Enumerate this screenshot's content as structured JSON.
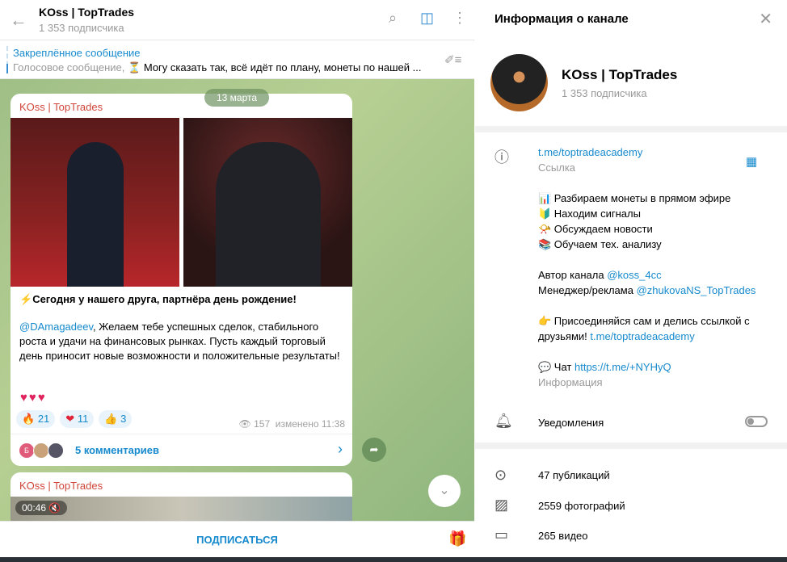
{
  "header": {
    "title": "KOss | TopTrades",
    "subtitle": "1 353 подписчика"
  },
  "pinned": {
    "label": "Закреплённое сообщение",
    "type": "Голосовое сообщение,",
    "text": "Могу сказать так, всё идёт по плану, монеты по нашей ..."
  },
  "chat": {
    "date": "13 марта",
    "post1": {
      "author": "KOss | TopTrades",
      "headline": "Сегодня у нашего друга, партнёра день рождение!",
      "mention": "@DAmagadeev",
      "body": ", Желаем тебе успешных сделок, стабильного роста и удачи на финансовых рынках. Пусть каждый торговый день приносит новые возможности и положительные результаты!",
      "reactions": [
        {
          "emoji": "🔥",
          "count": "21"
        },
        {
          "emoji": "❤",
          "count": "11"
        },
        {
          "emoji": "👍",
          "count": "3"
        }
      ],
      "views": "157",
      "edited": "изменено 11:38",
      "comments": "5 комментариев",
      "avatar_letter": "Б"
    },
    "post2": {
      "author": "KOss | TopTrades",
      "duration": "00:46"
    }
  },
  "bottom": {
    "subscribe": "ПОДПИСАТЬСЯ"
  },
  "info": {
    "title": "Информация о канале",
    "name": "KOss | TopTrades",
    "subscribers": "1 353 подписчика",
    "link": "t.me/toptradeacademy",
    "link_label": "Ссылка",
    "lines": [
      "📊 Разбираем монеты в прямом эфире",
      "🔰 Находим сигналы",
      "📯 Обсуждаем новости",
      "📚 Обучаем тех. анализу"
    ],
    "author_label": "Автор канала",
    "author": "@koss_4cc",
    "manager_label": "Менеджер/реклама",
    "manager": "@zhukovaNS_TopTrades",
    "join": "👉 Присоединяйся сам и делись ссылкой с друзьями!",
    "join_link": "t.me/toptradeacademy",
    "chat_label": "💬 Чат",
    "chat_link": "https://t.me/+NYHyQ",
    "desc_label": "Информация",
    "notifications": "Уведомления",
    "notifications_on": false,
    "stats": [
      "47 публикаций",
      "2559 фотографий",
      "265 видео"
    ]
  }
}
